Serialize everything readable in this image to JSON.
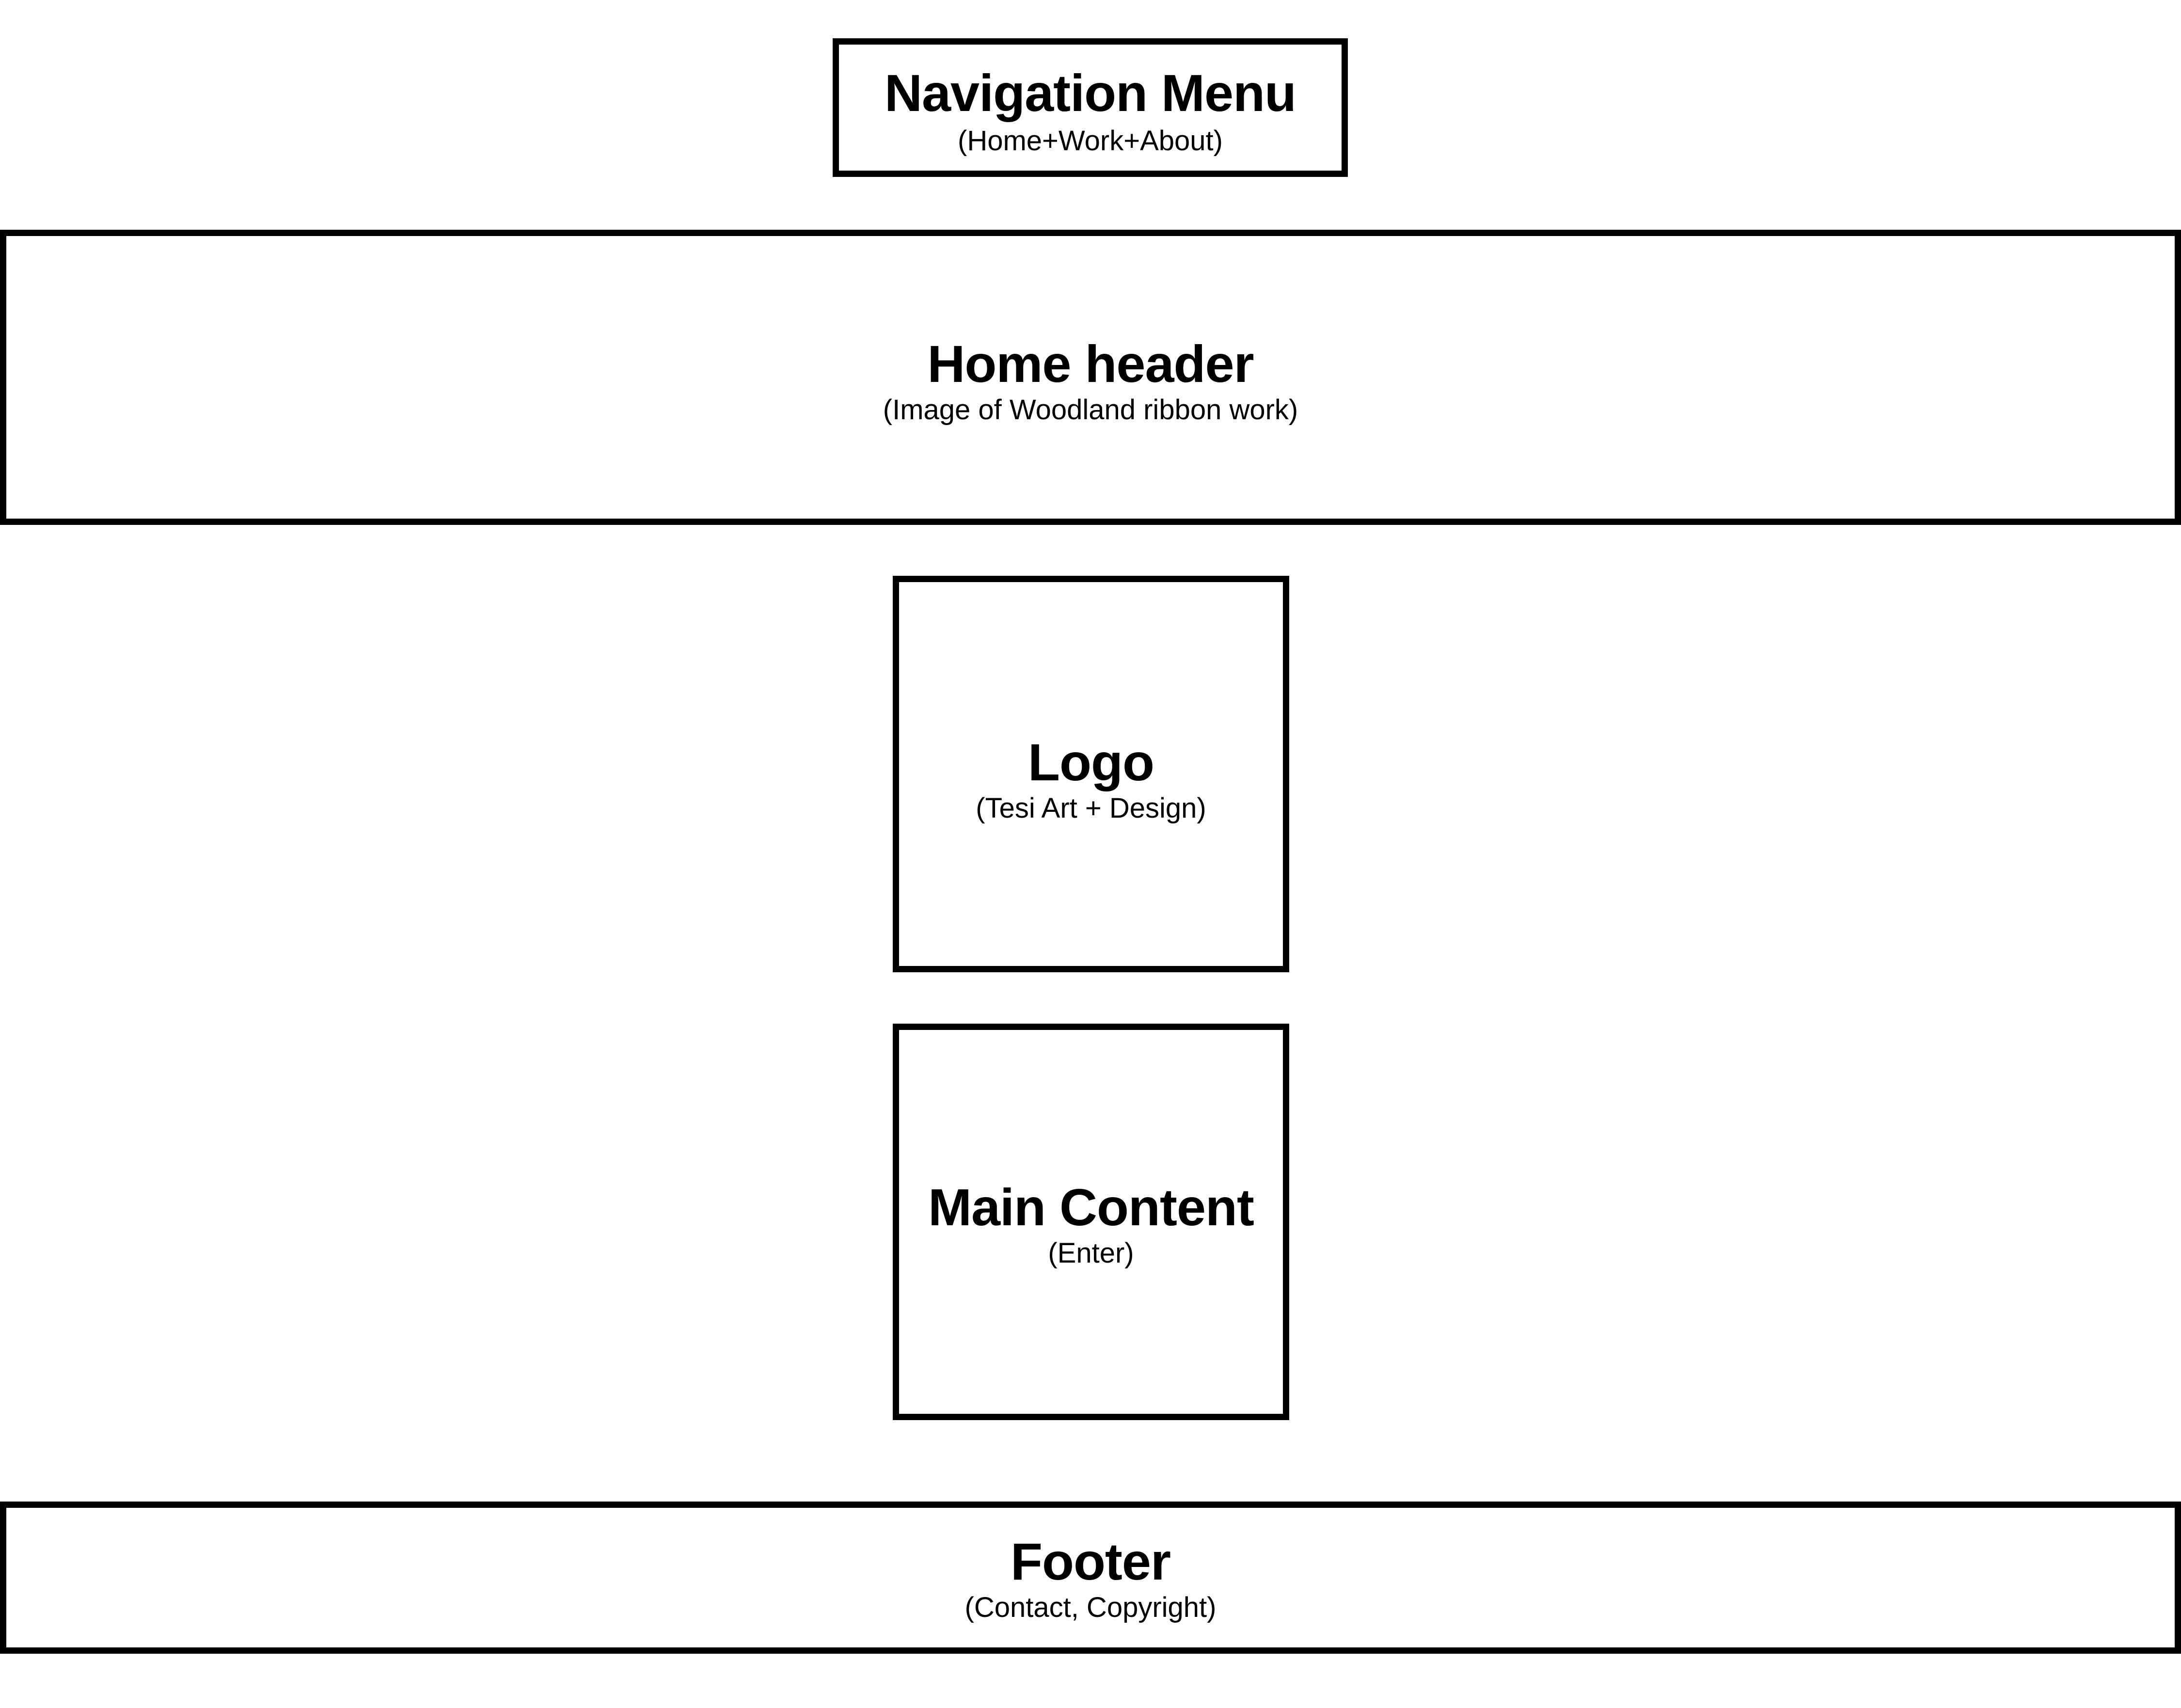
{
  "wireframe": {
    "nav": {
      "title": "Navigation Menu",
      "subtitle": "(Home+Work+About)"
    },
    "header": {
      "title": "Home header",
      "subtitle": "(Image of Woodland ribbon work)"
    },
    "logo": {
      "title": "Logo",
      "subtitle": "(Tesi Art + Design)"
    },
    "main": {
      "title": "Main Content",
      "subtitle": "(Enter)"
    },
    "footer": {
      "title": "Footer",
      "subtitle": "(Contact, Copyright)"
    }
  },
  "colors": {
    "stroke": "#000000",
    "background": "#ffffff"
  }
}
